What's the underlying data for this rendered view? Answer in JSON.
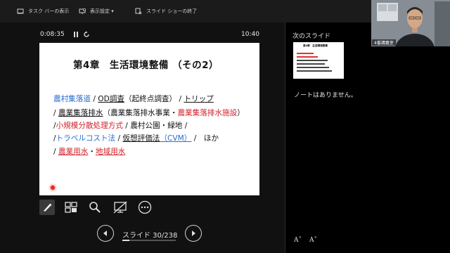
{
  "toolbar": {
    "taskbar_label": "タスク バーの表示",
    "display_settings_label": "表示設定 ▾",
    "end_show_label": "スライド ショーの終了"
  },
  "presenter": {
    "timer": "0:08:35",
    "clock": "10:40",
    "slide_counter": "スライド 30/238",
    "progress": 0.126
  },
  "slide": {
    "title": "第4章　生活環境整備 （その2）",
    "lines": [
      [
        {
          "text": "農村集落道",
          "style": "blue"
        },
        {
          "text": " / ",
          "style": "plain"
        },
        {
          "text": "OD調査",
          "style": "ul"
        },
        {
          "text": "（起終点調査） / ",
          "style": "plain"
        },
        {
          "text": "トリップ",
          "style": "ul"
        }
      ],
      [
        {
          "text": "/ ",
          "style": "plain"
        },
        {
          "text": "農業集落排水",
          "style": "ul"
        },
        {
          "text": "（農業集落排水事業・",
          "style": "plain"
        },
        {
          "text": "農業集落排水施設",
          "style": "red"
        },
        {
          "text": "）",
          "style": "plain"
        }
      ],
      [
        {
          "text": "/",
          "style": "plain"
        },
        {
          "text": "小規模分散処理方式",
          "style": "red"
        },
        {
          "text": " / 農村公園・緑地 /",
          "style": "plain"
        }
      ],
      [
        {
          "text": "/",
          "style": "plain"
        },
        {
          "text": "トラベルコスト法",
          "style": "blue"
        },
        {
          "text": " / ",
          "style": "plain"
        },
        {
          "text": "仮想評価法",
          "style": "ul"
        },
        {
          "text": "（CVM）",
          "style": "blue-ul"
        },
        {
          "text": " /　ほか",
          "style": "plain"
        }
      ],
      [
        {
          "text": "/ ",
          "style": "plain"
        },
        {
          "text": "農業用水",
          "style": "red-ul"
        },
        {
          "text": "・",
          "style": "plain"
        },
        {
          "text": "地域用水",
          "style": "red-ul"
        }
      ]
    ]
  },
  "sidepanel": {
    "next_slide_label": "次のスライド",
    "next_thumb_title": "第4章　生活環境整備",
    "notes_text": "ノートはありません。",
    "font_increase": "A˄",
    "font_decrease": "A˅"
  },
  "webcam": {
    "name_label": "4番講義室"
  },
  "colors": {
    "accent_blue": "#2a6bd0",
    "accent_red": "#d2212a",
    "laser": "#e32b2b"
  }
}
